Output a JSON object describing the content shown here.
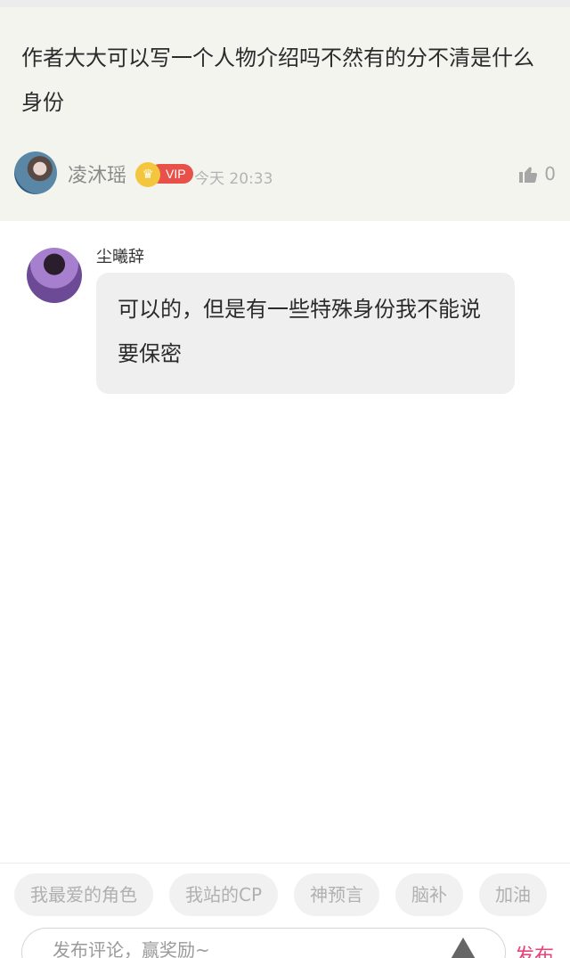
{
  "top_comment": {
    "text": "作者大大可以写一个人物介绍吗不然有的分不清是什么身份",
    "username": "凌沐瑶",
    "badge": "VIP",
    "crown_icon": "crown-icon",
    "timestamp": "今天 20:33",
    "like_count": "0"
  },
  "reply": {
    "username": "尘曦辞",
    "text": "可以的，但是有一些特殊身份我不能说要保密"
  },
  "bottom": {
    "chips": [
      "我最爱的角色",
      "我站的CP",
      "神预言",
      "脑补",
      "加油"
    ],
    "input_placeholder": "发布评论，赢奖励~",
    "publish_label": "发布"
  },
  "colors": {
    "accent_pink": "#e4457c",
    "vip_red": "#e8514a",
    "crown_gold": "#f3c63d"
  }
}
